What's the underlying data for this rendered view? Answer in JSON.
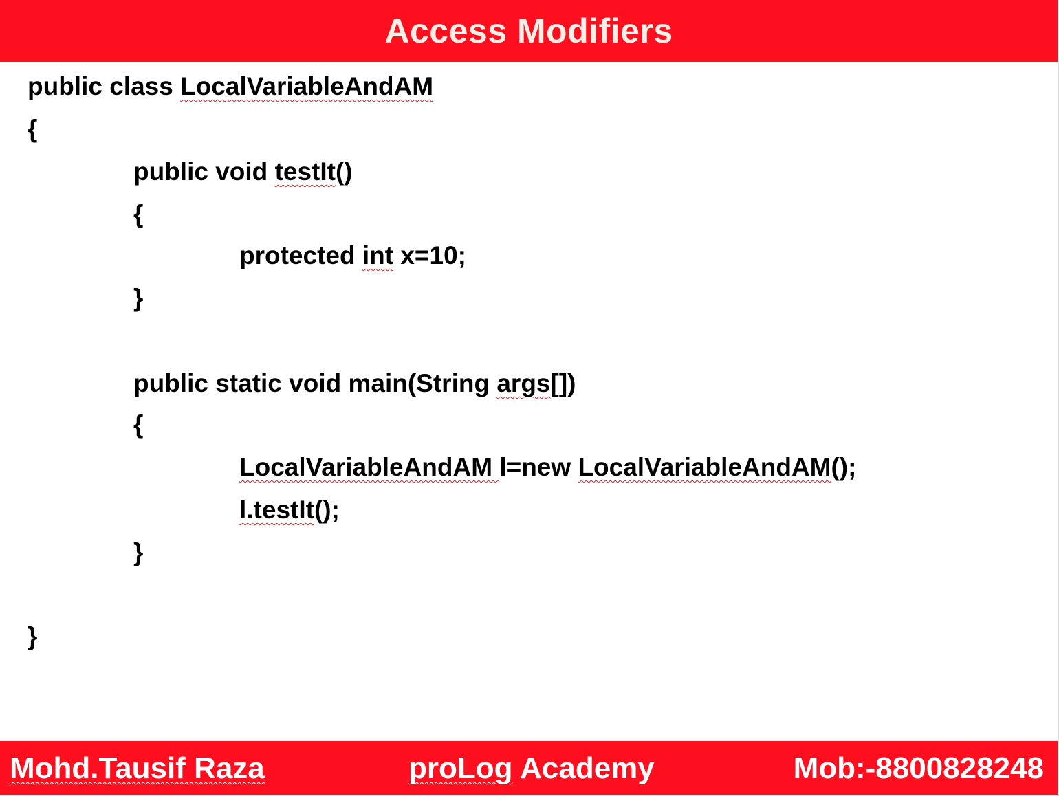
{
  "header": {
    "title": "Access Modifiers"
  },
  "code": {
    "line1_kw": "public class ",
    "line1_name": "LocalVariableAndAM",
    "line2": "{",
    "line3_kw": "public void ",
    "line3_name": "testIt",
    "line3_tail": "()",
    "line4": "{",
    "line5_kw": "protected ",
    "line5_type": "int",
    "line5_tail": " x=10;",
    "line6": "}",
    "line7_kw": "public static void main(String ",
    "line7_name": "args",
    "line7_tail": "[])",
    "line8": "{",
    "line9_name1": "LocalVariableAndAM ",
    "line9_mid": "l=new ",
    "line9_name2": "LocalVariableAndAM",
    "line9_tail": "();",
    "line10_name": "l.testIt",
    "line10_tail": "();",
    "line11": "}",
    "line12": "}"
  },
  "footer": {
    "author": "Mohd.Tausif Raza",
    "academy_name": "proLog",
    "academy_rest": " Academy",
    "mobile": "Mob:-8800828248"
  },
  "colors": {
    "banner": "#fe0f1f",
    "title_text": "#f5efe6",
    "spellcheck_underline": "#e01a1a"
  }
}
